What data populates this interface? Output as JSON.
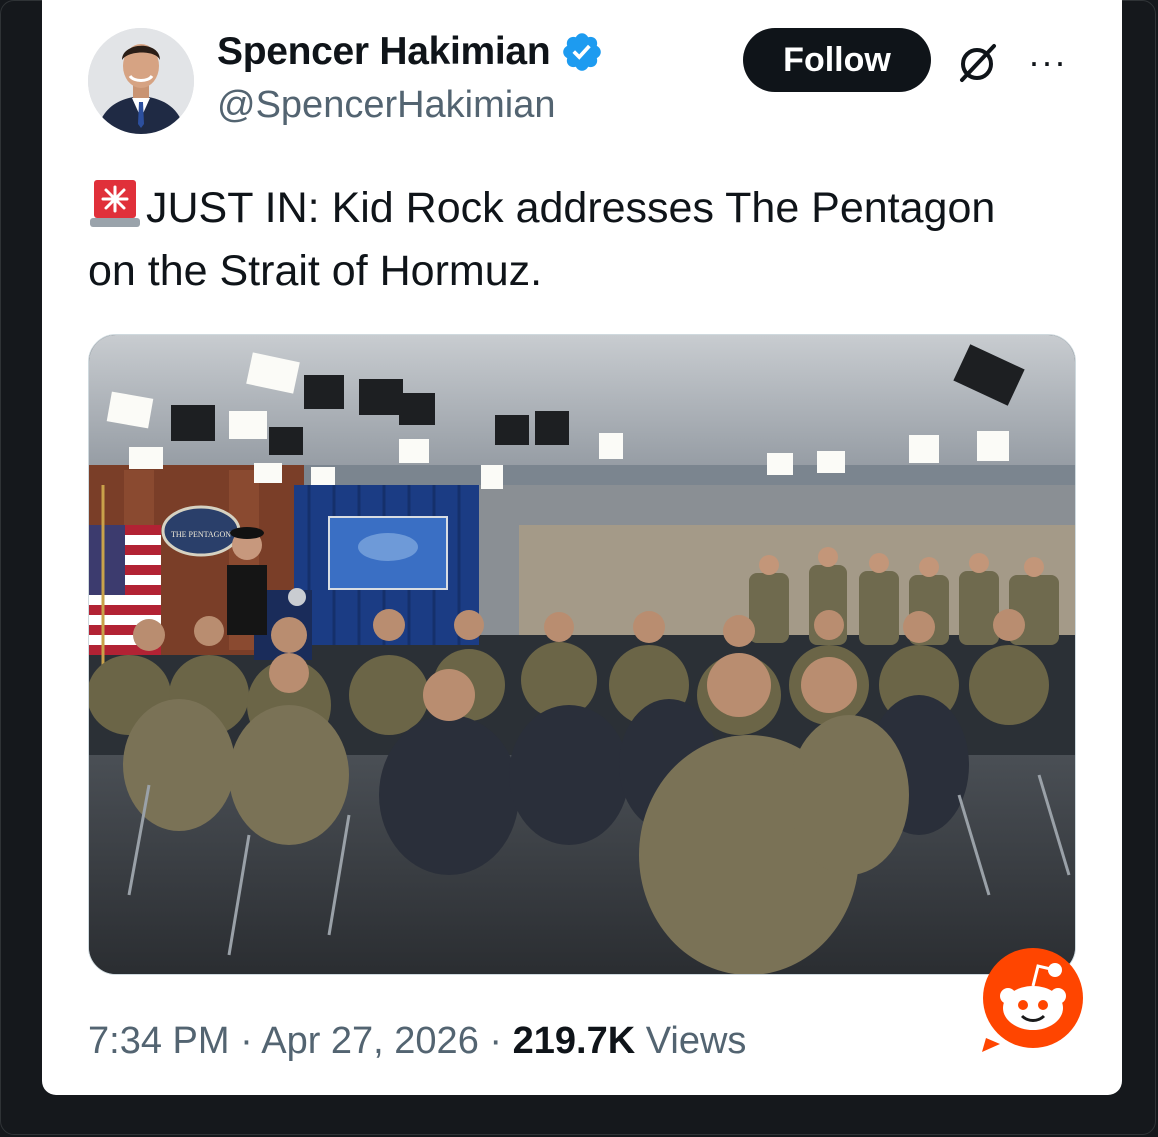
{
  "author": {
    "name": "Spencer Hakimian",
    "handle": "@SpencerHakimian",
    "verified": true
  },
  "actions": {
    "follow_label": "Follow",
    "grok_icon": "grok-slash-icon",
    "more_icon": "more-dots-icon",
    "more_label": "···"
  },
  "tweet": {
    "emoji": "rotating-light-siren",
    "text_line1": "JUST IN: Kid Rock addresses The Pentagon",
    "text_line2": "on the Strait of Hormuz."
  },
  "media": {
    "description_icon": "photo-pentagon-briefing-room",
    "seal_text": "THE PENTAGON"
  },
  "footer": {
    "time": "7:34 PM",
    "date": "Apr 27, 2026",
    "separator": "·",
    "views_count": "219.7K",
    "views_label": "Views"
  },
  "watermark": {
    "icon": "reddit-icon"
  },
  "colors": {
    "follow_bg": "#0f1419",
    "verified_blue": "#1d9bf0",
    "secondary_text": "#536471",
    "reddit_orange": "#ff4500"
  }
}
